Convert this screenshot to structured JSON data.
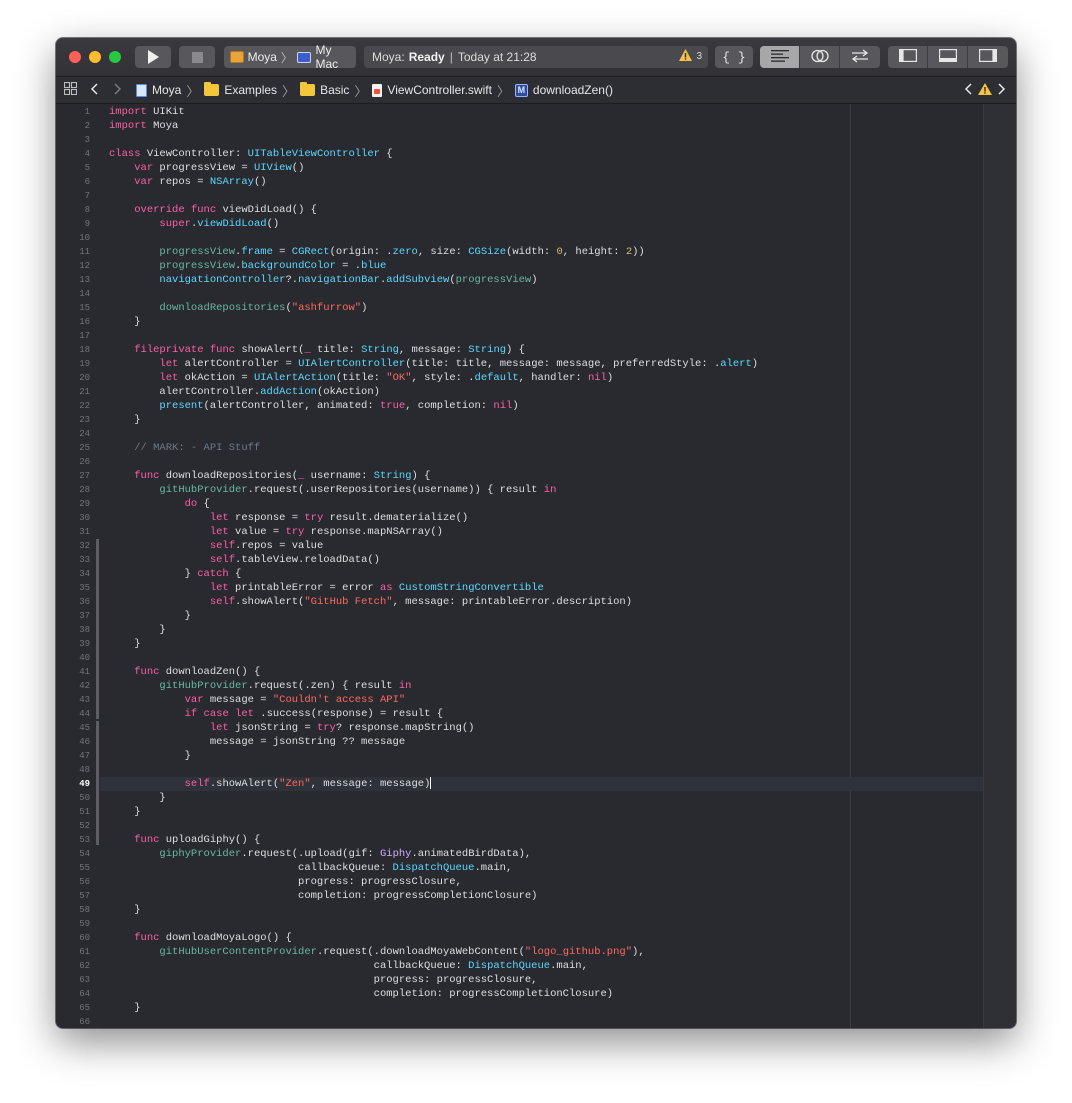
{
  "colors": {
    "window_bg": "#292a30",
    "keyword": "#fc5fa3",
    "type": "#5dd8ff",
    "project_type": "#d0a8ff",
    "project_member": "#67b7a4",
    "string": "#fc6a5d",
    "number": "#d0bf69",
    "comment": "#6c7986",
    "plain": "#dfdfe0"
  },
  "toolbar": {
    "run_icon": "play-icon",
    "stop_icon": "stop-icon",
    "scheme_name": "Moya",
    "destination": "My Mac",
    "status_app": "Moya:",
    "status_state": "Ready",
    "status_time": "Today at 21:28",
    "warning_count": "3",
    "library_label": "{ }"
  },
  "jumpbar": {
    "crumbs": [
      "Moya",
      "Examples",
      "Basic",
      "ViewController.swift",
      "downloadZen()"
    ]
  },
  "editor": {
    "current_line": 49,
    "lines": [
      [
        [
          "kw",
          "import"
        ],
        [
          "p",
          " UIKit"
        ]
      ],
      [
        [
          "kw",
          "import"
        ],
        [
          "p",
          " Moya"
        ]
      ],
      [],
      [
        [
          "kw",
          "class"
        ],
        [
          "p",
          " ViewController: "
        ],
        [
          "ty",
          "UITableViewController"
        ],
        [
          "p",
          " {"
        ]
      ],
      [
        [
          "p",
          "    "
        ],
        [
          "kw",
          "var"
        ],
        [
          "p",
          " progressView = "
        ],
        [
          "ty",
          "UIView"
        ],
        [
          "p",
          "()"
        ]
      ],
      [
        [
          "p",
          "    "
        ],
        [
          "kw",
          "var"
        ],
        [
          "p",
          " repos = "
        ],
        [
          "ty",
          "NSArray"
        ],
        [
          "p",
          "()"
        ]
      ],
      [],
      [
        [
          "p",
          "    "
        ],
        [
          "kw",
          "override"
        ],
        [
          "p",
          " "
        ],
        [
          "kw",
          "func"
        ],
        [
          "p",
          " viewDidLoad() {"
        ]
      ],
      [
        [
          "p",
          "        "
        ],
        [
          "kw",
          "super"
        ],
        [
          "p",
          "."
        ],
        [
          "ty",
          "viewDidLoad"
        ],
        [
          "p",
          "()"
        ]
      ],
      [],
      [
        [
          "p",
          "        "
        ],
        [
          "pr",
          "progressView"
        ],
        [
          "p",
          "."
        ],
        [
          "ty",
          "frame"
        ],
        [
          "p",
          " = "
        ],
        [
          "ty",
          "CGRect"
        ],
        [
          "p",
          "(origin: ."
        ],
        [
          "ty",
          "zero"
        ],
        [
          "p",
          ", size: "
        ],
        [
          "ty",
          "CGSize"
        ],
        [
          "p",
          "(width: "
        ],
        [
          "nu",
          "0"
        ],
        [
          "p",
          ", height: "
        ],
        [
          "nu",
          "2"
        ],
        [
          "p",
          "))"
        ]
      ],
      [
        [
          "p",
          "        "
        ],
        [
          "pr",
          "progressView"
        ],
        [
          "p",
          "."
        ],
        [
          "ty",
          "backgroundColor"
        ],
        [
          "p",
          " = ."
        ],
        [
          "ty",
          "blue"
        ]
      ],
      [
        [
          "p",
          "        "
        ],
        [
          "ty",
          "navigationController"
        ],
        [
          "p",
          "?."
        ],
        [
          "ty",
          "navigationBar"
        ],
        [
          "p",
          "."
        ],
        [
          "ty",
          "addSubview"
        ],
        [
          "p",
          "("
        ],
        [
          "pr",
          "progressView"
        ],
        [
          "p",
          ")"
        ]
      ],
      [],
      [
        [
          "p",
          "        "
        ],
        [
          "pr",
          "downloadRepositories"
        ],
        [
          "p",
          "("
        ],
        [
          "st",
          "\"ashfurrow\""
        ],
        [
          "p",
          ")"
        ]
      ],
      [
        [
          "p",
          "    }"
        ]
      ],
      [],
      [
        [
          "p",
          "    "
        ],
        [
          "kw",
          "fileprivate"
        ],
        [
          "p",
          " "
        ],
        [
          "kw",
          "func"
        ],
        [
          "p",
          " showAlert("
        ],
        [
          "kw",
          "_"
        ],
        [
          "p",
          " title: "
        ],
        [
          "ty",
          "String"
        ],
        [
          "p",
          ", message: "
        ],
        [
          "ty",
          "String"
        ],
        [
          "p",
          ") {"
        ]
      ],
      [
        [
          "p",
          "        "
        ],
        [
          "kw",
          "let"
        ],
        [
          "p",
          " alertController = "
        ],
        [
          "ty",
          "UIAlertController"
        ],
        [
          "p",
          "(title: title, message: message, preferredStyle: ."
        ],
        [
          "ty",
          "alert"
        ],
        [
          "p",
          ")"
        ]
      ],
      [
        [
          "p",
          "        "
        ],
        [
          "kw",
          "let"
        ],
        [
          "p",
          " okAction = "
        ],
        [
          "ty",
          "UIAlertAction"
        ],
        [
          "p",
          "(title: "
        ],
        [
          "st",
          "\"OK\""
        ],
        [
          "p",
          ", style: ."
        ],
        [
          "ty",
          "default"
        ],
        [
          "p",
          ", handler: "
        ],
        [
          "kw",
          "nil"
        ],
        [
          "p",
          ")"
        ]
      ],
      [
        [
          "p",
          "        alertController."
        ],
        [
          "ty",
          "addAction"
        ],
        [
          "p",
          "(okAction)"
        ]
      ],
      [
        [
          "p",
          "        "
        ],
        [
          "ty",
          "present"
        ],
        [
          "p",
          "(alertController, animated: "
        ],
        [
          "kw",
          "true"
        ],
        [
          "p",
          ", completion: "
        ],
        [
          "kw",
          "nil"
        ],
        [
          "p",
          ")"
        ]
      ],
      [
        [
          "p",
          "    }"
        ]
      ],
      [],
      [
        [
          "p",
          "    "
        ],
        [
          "cm",
          "// MARK: - API Stuff"
        ]
      ],
      [],
      [
        [
          "p",
          "    "
        ],
        [
          "kw",
          "func"
        ],
        [
          "p",
          " downloadRepositories("
        ],
        [
          "kw",
          "_"
        ],
        [
          "p",
          " username: "
        ],
        [
          "ty",
          "String"
        ],
        [
          "p",
          ") {"
        ]
      ],
      [
        [
          "p",
          "        "
        ],
        [
          "pr",
          "gitHubProvider"
        ],
        [
          "p",
          ".request(.userRepositories(username)) { result "
        ],
        [
          "kw",
          "in"
        ]
      ],
      [
        [
          "p",
          "            "
        ],
        [
          "kw",
          "do"
        ],
        [
          "p",
          " {"
        ]
      ],
      [
        [
          "p",
          "                "
        ],
        [
          "kw",
          "let"
        ],
        [
          "p",
          " response = "
        ],
        [
          "kw",
          "try"
        ],
        [
          "p",
          " result.dematerialize()"
        ]
      ],
      [
        [
          "p",
          "                "
        ],
        [
          "kw",
          "let"
        ],
        [
          "p",
          " value = "
        ],
        [
          "kw",
          "try"
        ],
        [
          "p",
          " response.mapNSArray()"
        ]
      ],
      [
        [
          "p",
          "                "
        ],
        [
          "kw",
          "self"
        ],
        [
          "p",
          ".repos = value"
        ]
      ],
      [
        [
          "p",
          "                "
        ],
        [
          "kw",
          "self"
        ],
        [
          "p",
          ".tableView.reloadData()"
        ]
      ],
      [
        [
          "p",
          "            } "
        ],
        [
          "kw",
          "catch"
        ],
        [
          "p",
          " {"
        ]
      ],
      [
        [
          "p",
          "                "
        ],
        [
          "kw",
          "let"
        ],
        [
          "p",
          " printableError = error "
        ],
        [
          "kw",
          "as"
        ],
        [
          "p",
          " "
        ],
        [
          "ty",
          "CustomStringConvertible"
        ]
      ],
      [
        [
          "p",
          "                "
        ],
        [
          "kw",
          "self"
        ],
        [
          "p",
          ".showAlert("
        ],
        [
          "st",
          "\"GitHub Fetch\""
        ],
        [
          "p",
          ", message: printableError.description)"
        ]
      ],
      [
        [
          "p",
          "            }"
        ]
      ],
      [
        [
          "p",
          "        }"
        ]
      ],
      [
        [
          "p",
          "    }"
        ]
      ],
      [],
      [
        [
          "p",
          "    "
        ],
        [
          "kw",
          "func"
        ],
        [
          "p",
          " downloadZen() {"
        ]
      ],
      [
        [
          "p",
          "        "
        ],
        [
          "pr",
          "gitHubProvider"
        ],
        [
          "p",
          ".request(.zen) { result "
        ],
        [
          "kw",
          "in"
        ]
      ],
      [
        [
          "p",
          "            "
        ],
        [
          "kw",
          "var"
        ],
        [
          "p",
          " message = "
        ],
        [
          "st",
          "\"Couldn't access API\""
        ]
      ],
      [
        [
          "p",
          "            "
        ],
        [
          "kw",
          "if"
        ],
        [
          "p",
          " "
        ],
        [
          "kw",
          "case"
        ],
        [
          "p",
          " "
        ],
        [
          "kw",
          "let"
        ],
        [
          "p",
          " .success(response) = result {"
        ]
      ],
      [
        [
          "p",
          "                "
        ],
        [
          "kw",
          "let"
        ],
        [
          "p",
          " jsonString = "
        ],
        [
          "kw",
          "try"
        ],
        [
          "p",
          "? response.mapString()"
        ]
      ],
      [
        [
          "p",
          "                message = jsonString ?? message"
        ]
      ],
      [
        [
          "p",
          "            }"
        ]
      ],
      [],
      [
        [
          "p",
          "            "
        ],
        [
          "kw",
          "self"
        ],
        [
          "p",
          ".showAlert("
        ],
        [
          "st",
          "\"Zen\""
        ],
        [
          "p",
          ", message: message)"
        ]
      ],
      [
        [
          "p",
          "        }"
        ]
      ],
      [
        [
          "p",
          "    }"
        ]
      ],
      [],
      [
        [
          "p",
          "    "
        ],
        [
          "kw",
          "func"
        ],
        [
          "p",
          " uploadGiphy() {"
        ]
      ],
      [
        [
          "p",
          "        "
        ],
        [
          "pr",
          "giphyProvider"
        ],
        [
          "p",
          ".request(.upload(gif: "
        ],
        [
          "tp",
          "Giphy"
        ],
        [
          "p",
          ".animatedBirdData),"
        ]
      ],
      [
        [
          "p",
          "                              callbackQueue: "
        ],
        [
          "ty",
          "DispatchQueue"
        ],
        [
          "p",
          ".main,"
        ]
      ],
      [
        [
          "p",
          "                              progress: progressClosure,"
        ]
      ],
      [
        [
          "p",
          "                              completion: progressCompletionClosure)"
        ]
      ],
      [
        [
          "p",
          "    }"
        ]
      ],
      [],
      [
        [
          "p",
          "    "
        ],
        [
          "kw",
          "func"
        ],
        [
          "p",
          " downloadMoyaLogo() {"
        ]
      ],
      [
        [
          "p",
          "        "
        ],
        [
          "pr",
          "gitHubUserContentProvider"
        ],
        [
          "p",
          ".request(.downloadMoyaWebContent("
        ],
        [
          "st",
          "\"logo_github.png\""
        ],
        [
          "p",
          "),"
        ]
      ],
      [
        [
          "p",
          "                                          callbackQueue: "
        ],
        [
          "ty",
          "DispatchQueue"
        ],
        [
          "p",
          ".main,"
        ]
      ],
      [
        [
          "p",
          "                                          progress: progressClosure,"
        ]
      ],
      [
        [
          "p",
          "                                          completion: progressCompletionClosure)"
        ]
      ],
      [
        [
          "p",
          "    }"
        ]
      ],
      []
    ]
  }
}
